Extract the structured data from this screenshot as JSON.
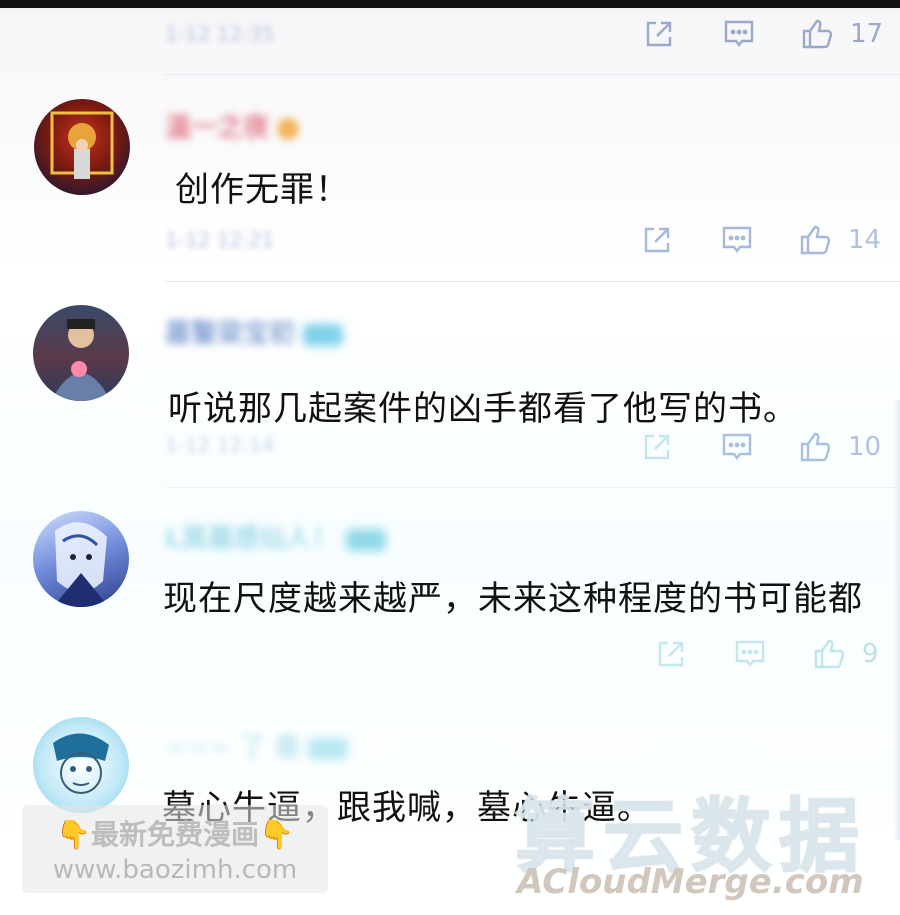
{
  "colors": {
    "icon": "#9aa8cc",
    "icon_faint": "#bfe4ee",
    "name_blur": "#8aa6d6",
    "badge": "#7fd0ea"
  },
  "icons": [
    "share-icon",
    "reply-icon",
    "thumbs-up-icon"
  ],
  "comments": [
    {
      "text": "",
      "likes": "17"
    },
    {
      "text": "创作无罪！",
      "likes": "14"
    },
    {
      "text": "听说那几起案件的凶手都看了他写的书。",
      "likes": "10"
    },
    {
      "text": "现在尺度越来越严，未来这种程度的书可能都",
      "likes": "9"
    },
    {
      "text": "墓心牛逼，跟我喊，墓心牛逼。",
      "likes": ""
    }
  ],
  "watermarks": {
    "left_line1": "最新免费漫画",
    "left_line2": "www.baozimh.com",
    "right_big": "算云数据",
    "right_small": "ACloudMerge.com",
    "hand": "👇"
  }
}
